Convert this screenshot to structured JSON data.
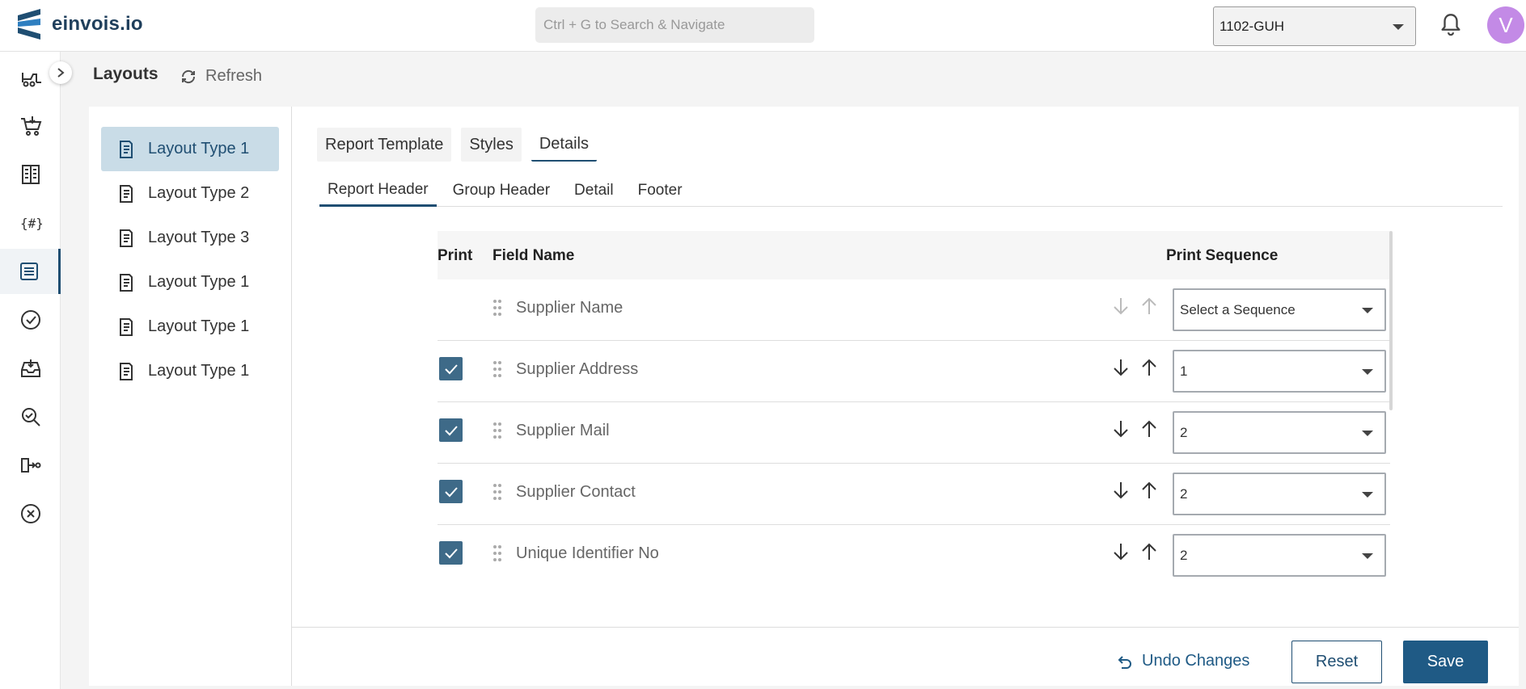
{
  "app": {
    "logo_text": "einvois.io",
    "search_placeholder": "Ctrl + G to Search & Navigate",
    "company": "1102-GUH",
    "avatar_initial": "V",
    "avatar_color": "#c38ae6"
  },
  "rail": {
    "icons": [
      "forklift-icon",
      "cart-icon",
      "ledger-icon",
      "hash-braces-icon",
      "document-list-icon",
      "check-circle-icon",
      "inbox-download-icon",
      "search-document-icon",
      "flow-icon",
      "cancel-circle-icon"
    ],
    "active_index": 4
  },
  "page": {
    "title": "Layouts",
    "refresh_label": "Refresh"
  },
  "layouts": [
    "Layout Type 1",
    "Layout Type 2",
    "Layout Type 3",
    "Layout Type 1",
    "Layout Type 1",
    "Layout Type 1"
  ],
  "tabs": [
    "Report Template",
    "Styles",
    "Details"
  ],
  "subtabs": [
    "Report Header",
    "Group Header",
    "Detail",
    "Footer"
  ],
  "table": {
    "headers": {
      "print": "Print",
      "field_name": "Field Name",
      "print_sequence": "Print Sequence"
    },
    "rows": [
      {
        "checked": false,
        "field": "Supplier Name",
        "sequence": "Select a Sequence",
        "arrows_enabled": false
      },
      {
        "checked": true,
        "field": "Supplier Address",
        "sequence": "1",
        "arrows_enabled": true
      },
      {
        "checked": true,
        "field": "Supplier Mail",
        "sequence": "2",
        "arrows_enabled": true
      },
      {
        "checked": true,
        "field": "Supplier Contact",
        "sequence": "2",
        "arrows_enabled": true
      },
      {
        "checked": true,
        "field": "Unique Identifier No",
        "sequence": "2",
        "arrows_enabled": true
      }
    ]
  },
  "footer": {
    "undo_label": "Undo Changes",
    "reset_label": "Reset",
    "save_label": "Save"
  },
  "colors": {
    "primary": "#1f5a85",
    "checkbox": "#3e6a88",
    "active_item_bg": "#c9dce7"
  }
}
